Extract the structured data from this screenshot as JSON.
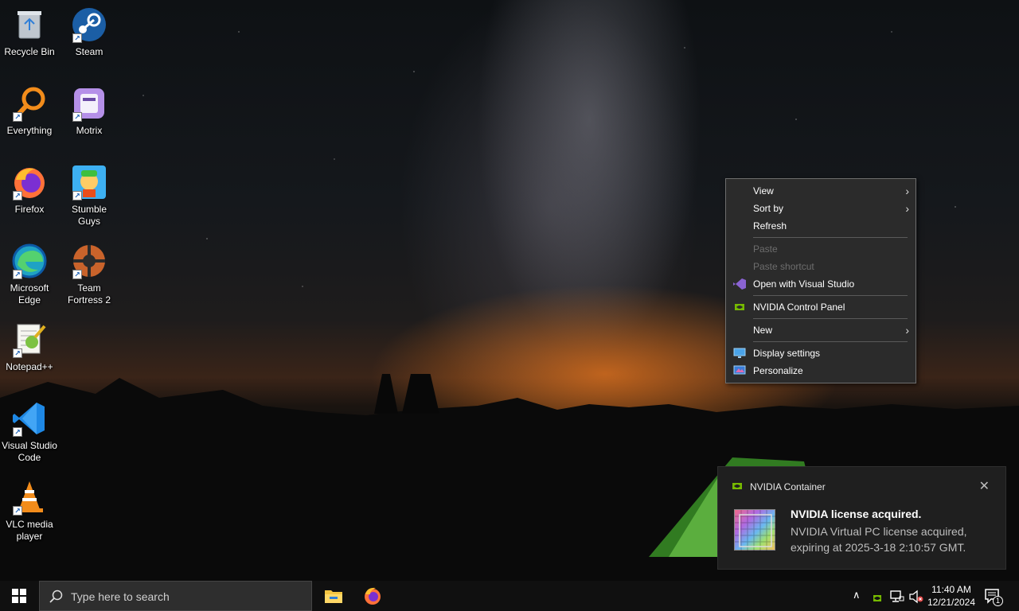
{
  "desktop": {
    "icons": [
      {
        "label": "Recycle Bin"
      },
      {
        "label": "Steam"
      },
      {
        "label": "Everything"
      },
      {
        "label": "Motrix"
      },
      {
        "label": "Firefox"
      },
      {
        "label": "Stumble Guys"
      },
      {
        "label": "Microsoft Edge"
      },
      {
        "label": "Team Fortress 2"
      },
      {
        "label": "Notepad++"
      },
      {
        "label": "Visual Studio Code"
      },
      {
        "label": "VLC media player"
      }
    ]
  },
  "context_menu": {
    "items": [
      {
        "label": "View",
        "submenu": true
      },
      {
        "label": "Sort by",
        "submenu": true
      },
      {
        "label": "Refresh"
      },
      {
        "label": "Paste",
        "disabled": true
      },
      {
        "label": "Paste shortcut",
        "disabled": true
      },
      {
        "label": "Open with Visual Studio",
        "icon": "visual-studio-icon"
      },
      {
        "label": "NVIDIA Control Panel",
        "icon": "nvidia-icon"
      },
      {
        "label": "New",
        "submenu": true
      },
      {
        "label": "Display settings",
        "icon": "display-icon"
      },
      {
        "label": "Personalize",
        "icon": "personalize-icon"
      }
    ]
  },
  "notification": {
    "app_name": "NVIDIA Container",
    "title": "NVIDIA license acquired.",
    "body": "NVIDIA Virtual PC license acquired, expiring at 2025-3-18 2:10:57 GMT.",
    "close_symbol": "✕"
  },
  "taskbar": {
    "search_placeholder": "Type here to search",
    "pinned": [
      "file-explorer-icon",
      "firefox-icon"
    ],
    "tray": {
      "overflow_symbol": "∧",
      "time": "11:40 AM",
      "date": "12/21/2024",
      "notification_count": "1"
    }
  },
  "colors": {
    "menu_bg": "#2b2b2b",
    "taskbar_bg": "#101010",
    "toast_bg": "#1f1f1f",
    "nvidia_green": "#76b900",
    "accent_blue": "#0078d4"
  }
}
